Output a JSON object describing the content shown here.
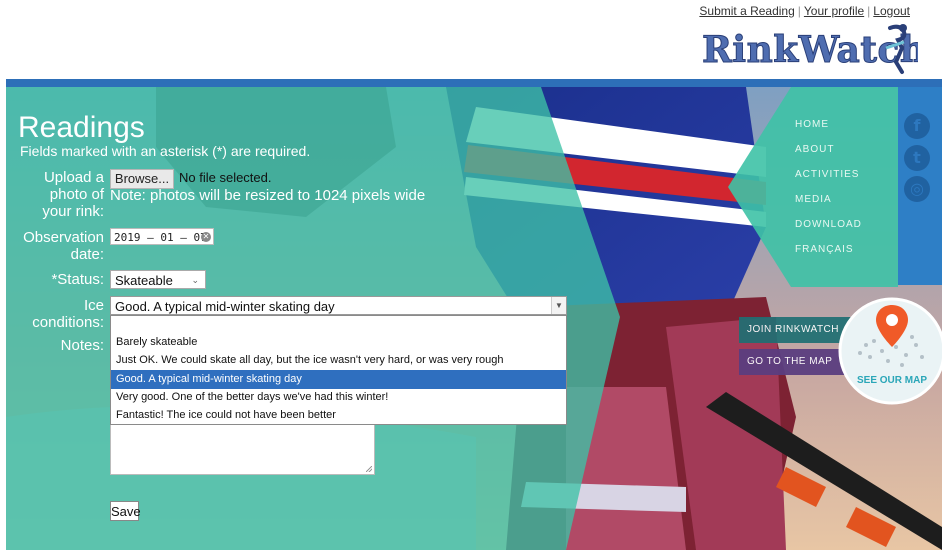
{
  "header": {
    "links": [
      "Submit a Reading",
      "Your profile",
      "Logout"
    ],
    "logo_text": "RinkWatch"
  },
  "form": {
    "title": "Readings",
    "required_note": "Fields marked with an asterisk (*) are required.",
    "upload_label_1": "Upload a",
    "upload_label_2": "photo of",
    "upload_label_3": "your rink:",
    "browse_label": "Browse...",
    "no_file": "No file selected.",
    "upload_note": "Note: photos will be resized to 1024 pixels wide",
    "obs_label_1": "Observation",
    "obs_label_2": "date:",
    "date_value": "2019 – 01 – 07",
    "status_label": "*Status:",
    "status_value": "Skateable",
    "ice_label_1": "Ice",
    "ice_label_2": "conditions:",
    "ice_value": "Good. A typical mid-winter skating day",
    "ice_options": [
      "",
      "Barely skateable",
      "Just OK. We could skate all day, but the ice wasn't very hard, or was very rough",
      "Good. A typical mid-winter skating day",
      "Very good. One of the better days we've had this winter!",
      "Fantastic! The ice could not have been better"
    ],
    "notes_label": "Notes:",
    "save_label": "Save"
  },
  "nav": {
    "items": [
      "HOME",
      "ABOUT",
      "ACTIVITIES",
      "MEDIA",
      "DOWNLOAD",
      "FRANÇAIS"
    ],
    "join": "JOIN RINKWATCH",
    "map": "GO TO THE MAP",
    "see_map": "SEE OUR MAP"
  },
  "social": [
    "facebook-icon",
    "twitter-icon",
    "instagram-icon"
  ],
  "colors": {
    "topbar": "#2d6fb8",
    "teal": "#3ec2a6",
    "nav_blue": "#2e7fc6",
    "selected_option": "#2f6fbf"
  }
}
